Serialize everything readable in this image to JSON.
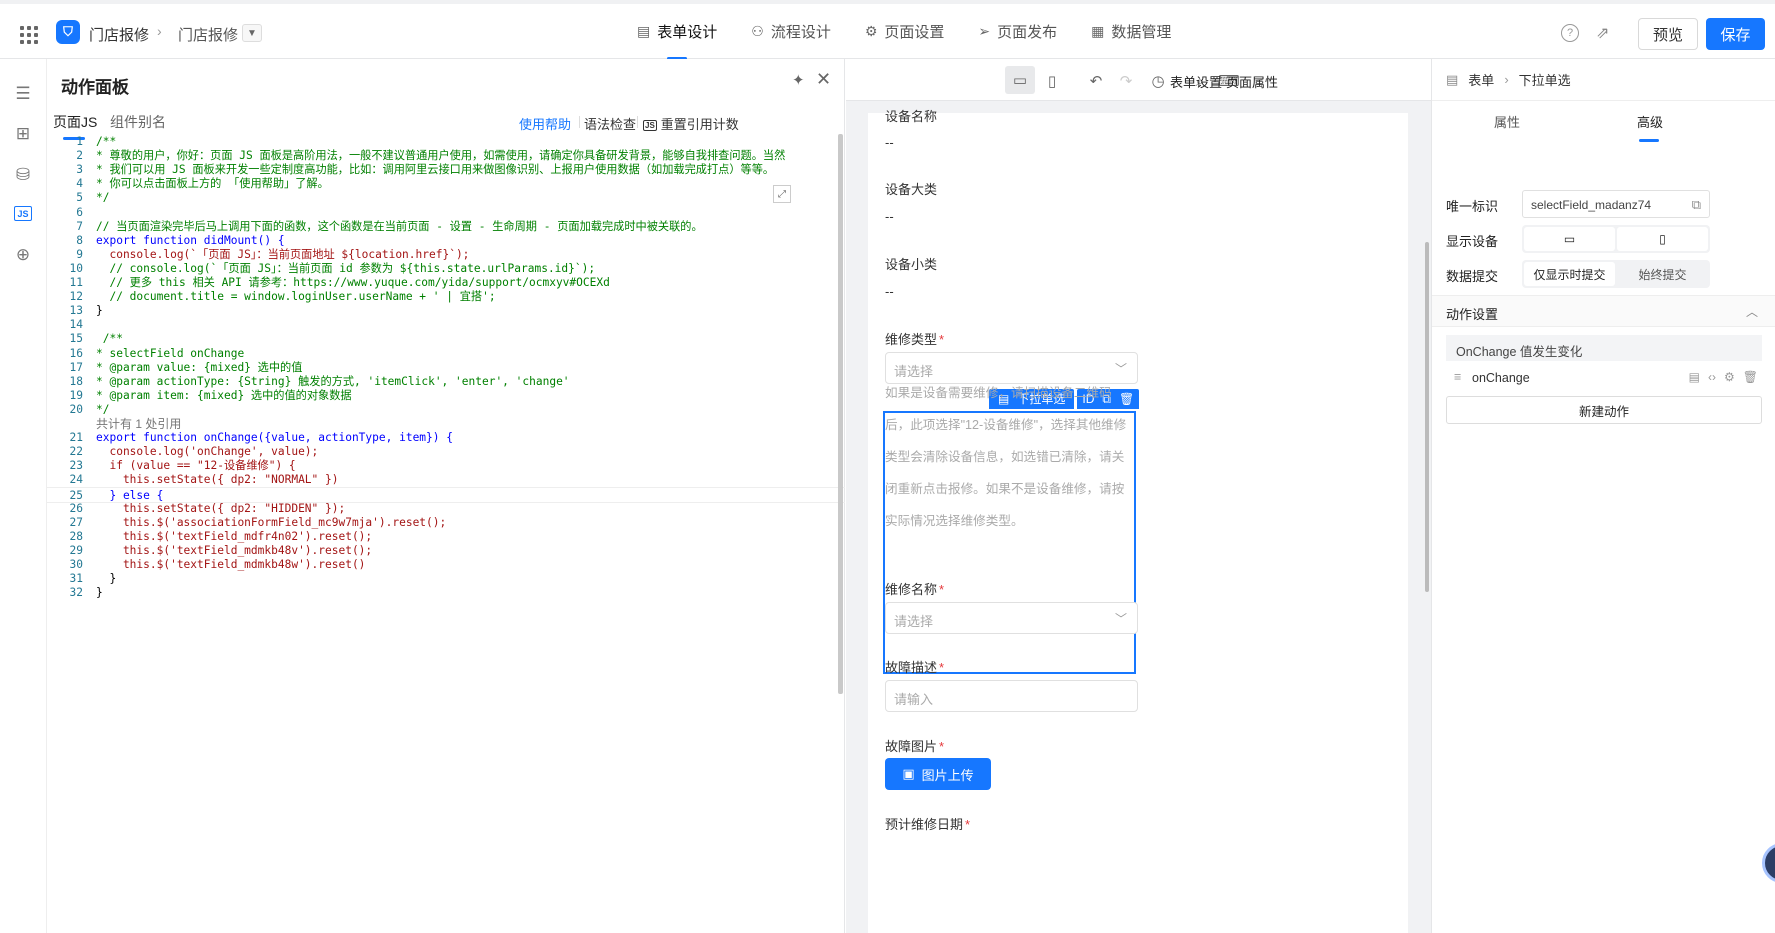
{
  "header": {
    "app_name": "门店报修",
    "page_name": "门店报修",
    "tabs": [
      {
        "label": "表单设计",
        "icon": "doc-icon"
      },
      {
        "label": "流程设计",
        "icon": "flow-icon"
      },
      {
        "label": "页面设置",
        "icon": "gear-icon"
      },
      {
        "label": "页面发布",
        "icon": "send-icon"
      },
      {
        "label": "数据管理",
        "icon": "table-icon"
      }
    ],
    "preview_label": "预览",
    "save_label": "保存"
  },
  "action_panel": {
    "title": "动作面板",
    "tabs": [
      "页面JS",
      "组件别名"
    ],
    "help_link": "使用帮助",
    "syntax_check": "语法检查",
    "reset_refs": "重置引用计数",
    "code_lines": [
      {
        "n": "1",
        "t": "/**",
        "c": "com"
      },
      {
        "n": "2",
        "t": "* 尊敬的用户，你好：页面 JS 面板是高阶用法，一般不建议普通用户使用，如需使用，请确定你具备研发背景，能够自我排查问题。当然",
        "c": "com"
      },
      {
        "n": "3",
        "t": "* 我们可以用 JS 面板来开发一些定制度高功能，比如：调用阿里云接口用来做图像识别、上报用户使用数据（如加载完成打点）等等。",
        "c": "com"
      },
      {
        "n": "4",
        "t": "* 你可以点击面板上方的 「使用帮助」了解。",
        "c": "com"
      },
      {
        "n": "5",
        "t": "*/",
        "c": "com"
      },
      {
        "n": "6",
        "t": "",
        "c": "def"
      },
      {
        "n": "7",
        "t": "// 当页面渲染完毕后马上调用下面的函数，这个函数是在当前页面 - 设置 - 生命周期 - 页面加载完成时中被关联的。",
        "c": "com"
      },
      {
        "n": "8",
        "t": "export function didMount() {",
        "c": "kw"
      },
      {
        "n": "9",
        "t": "  console.log(`「页面 JS」：当前页面地址 ${location.href}`);",
        "c": "str"
      },
      {
        "n": "10",
        "t": "  // console.log(`「页面 JS」：当前页面 id 参数为 ${this.state.urlParams.id}`);",
        "c": "com"
      },
      {
        "n": "11",
        "t": "  // 更多 this 相关 API 请参考：https://www.yuque.com/yida/support/ocmxyv#OCEXd",
        "c": "com"
      },
      {
        "n": "12",
        "t": "  // document.title = window.loginUser.userName + ' | 宜搭';",
        "c": "com"
      },
      {
        "n": "13",
        "t": "}",
        "c": "def"
      },
      {
        "n": "14",
        "t": "",
        "c": "def"
      },
      {
        "n": "15",
        "t": " /**",
        "c": "com"
      },
      {
        "n": "16",
        "t": "* selectField onChange",
        "c": "com"
      },
      {
        "n": "17",
        "t": "* @param value: {mixed} 选中的值",
        "c": "com"
      },
      {
        "n": "18",
        "t": "* @param actionType: {String} 触发的方式, 'itemClick', 'enter', 'change'",
        "c": "com"
      },
      {
        "n": "19",
        "t": "* @param item: {mixed} 选中的值的对象数据",
        "c": "com"
      },
      {
        "n": "20",
        "t": "*/",
        "c": "com"
      },
      {
        "n": "",
        "t": "共计有 1 处引用",
        "c": "meta"
      },
      {
        "n": "21",
        "t": "export function onChange({value, actionType, item}) {",
        "c": "kw"
      },
      {
        "n": "22",
        "t": "  console.log('onChange', value);",
        "c": "str"
      },
      {
        "n": "23",
        "t": "  if (value == \"12-设备维修\") {",
        "c": "str"
      },
      {
        "n": "24",
        "t": "    this.setState({ dp2: \"NORMAL\" })",
        "c": "str"
      },
      {
        "n": "25",
        "t": "  } else {",
        "c": "kw"
      },
      {
        "n": "26",
        "t": "    this.setState({ dp2: \"HIDDEN\" });",
        "c": "str"
      },
      {
        "n": "27",
        "t": "    this.$('associationFormField_mc9w7mja').reset();",
        "c": "str"
      },
      {
        "n": "28",
        "t": "    this.$('textField_mdfr4n02').reset();",
        "c": "str"
      },
      {
        "n": "29",
        "t": "    this.$('textField_mdmkb48v').reset();",
        "c": "str"
      },
      {
        "n": "30",
        "t": "    this.$('textField_mdmkb48w').reset()",
        "c": "str"
      },
      {
        "n": "31",
        "t": "  }",
        "c": "def"
      },
      {
        "n": "32",
        "t": "}",
        "c": "def"
      }
    ]
  },
  "canvas_toolbar": {
    "form_settings": "表单设置",
    "page_props": "页面属性"
  },
  "form": {
    "device_name_label": "设备名称",
    "device_name_value": "--",
    "device_category_label": "设备大类",
    "device_category_value": "--",
    "device_subcategory_label": "设备小类",
    "device_subcategory_value": "--",
    "selected_component_tag": "下拉单选",
    "selected_component_id": "ID",
    "repair_type_label": "维修类型",
    "repair_type_placeholder": "请选择",
    "repair_type_hint": "如果是设备需要维修，请扫描设备二维码后，此项选择\"12-设备维修\"，选择其他维修类型会清除设备信息，如选错已清除，请关闭重新点击报修。如果不是设备维修，请按实际情况选择维修类型。",
    "repair_name_label": "维修名称",
    "repair_name_placeholder": "请选择",
    "fault_desc_label": "故障描述",
    "fault_desc_placeholder": "请输入",
    "fault_photo_label": "故障图片",
    "upload_label": "图片上传",
    "expected_date_label": "预计维修日期",
    "required_mark": "*"
  },
  "settings": {
    "breadcrumb_root": "表单",
    "breadcrumb_current": "下拉单选",
    "tabs": [
      "属性",
      "高级"
    ],
    "unique_id_label": "唯一标识",
    "unique_id_value": "selectField_madanz74",
    "display_device_label": "显示设备",
    "data_submit_label": "数据提交",
    "submit_options": [
      "仅显示时提交",
      "始终提交"
    ],
    "action_section": "动作设置",
    "event_label": "OnChange 值发生变化",
    "handler_name": "onChange",
    "new_action": "新建动作"
  }
}
